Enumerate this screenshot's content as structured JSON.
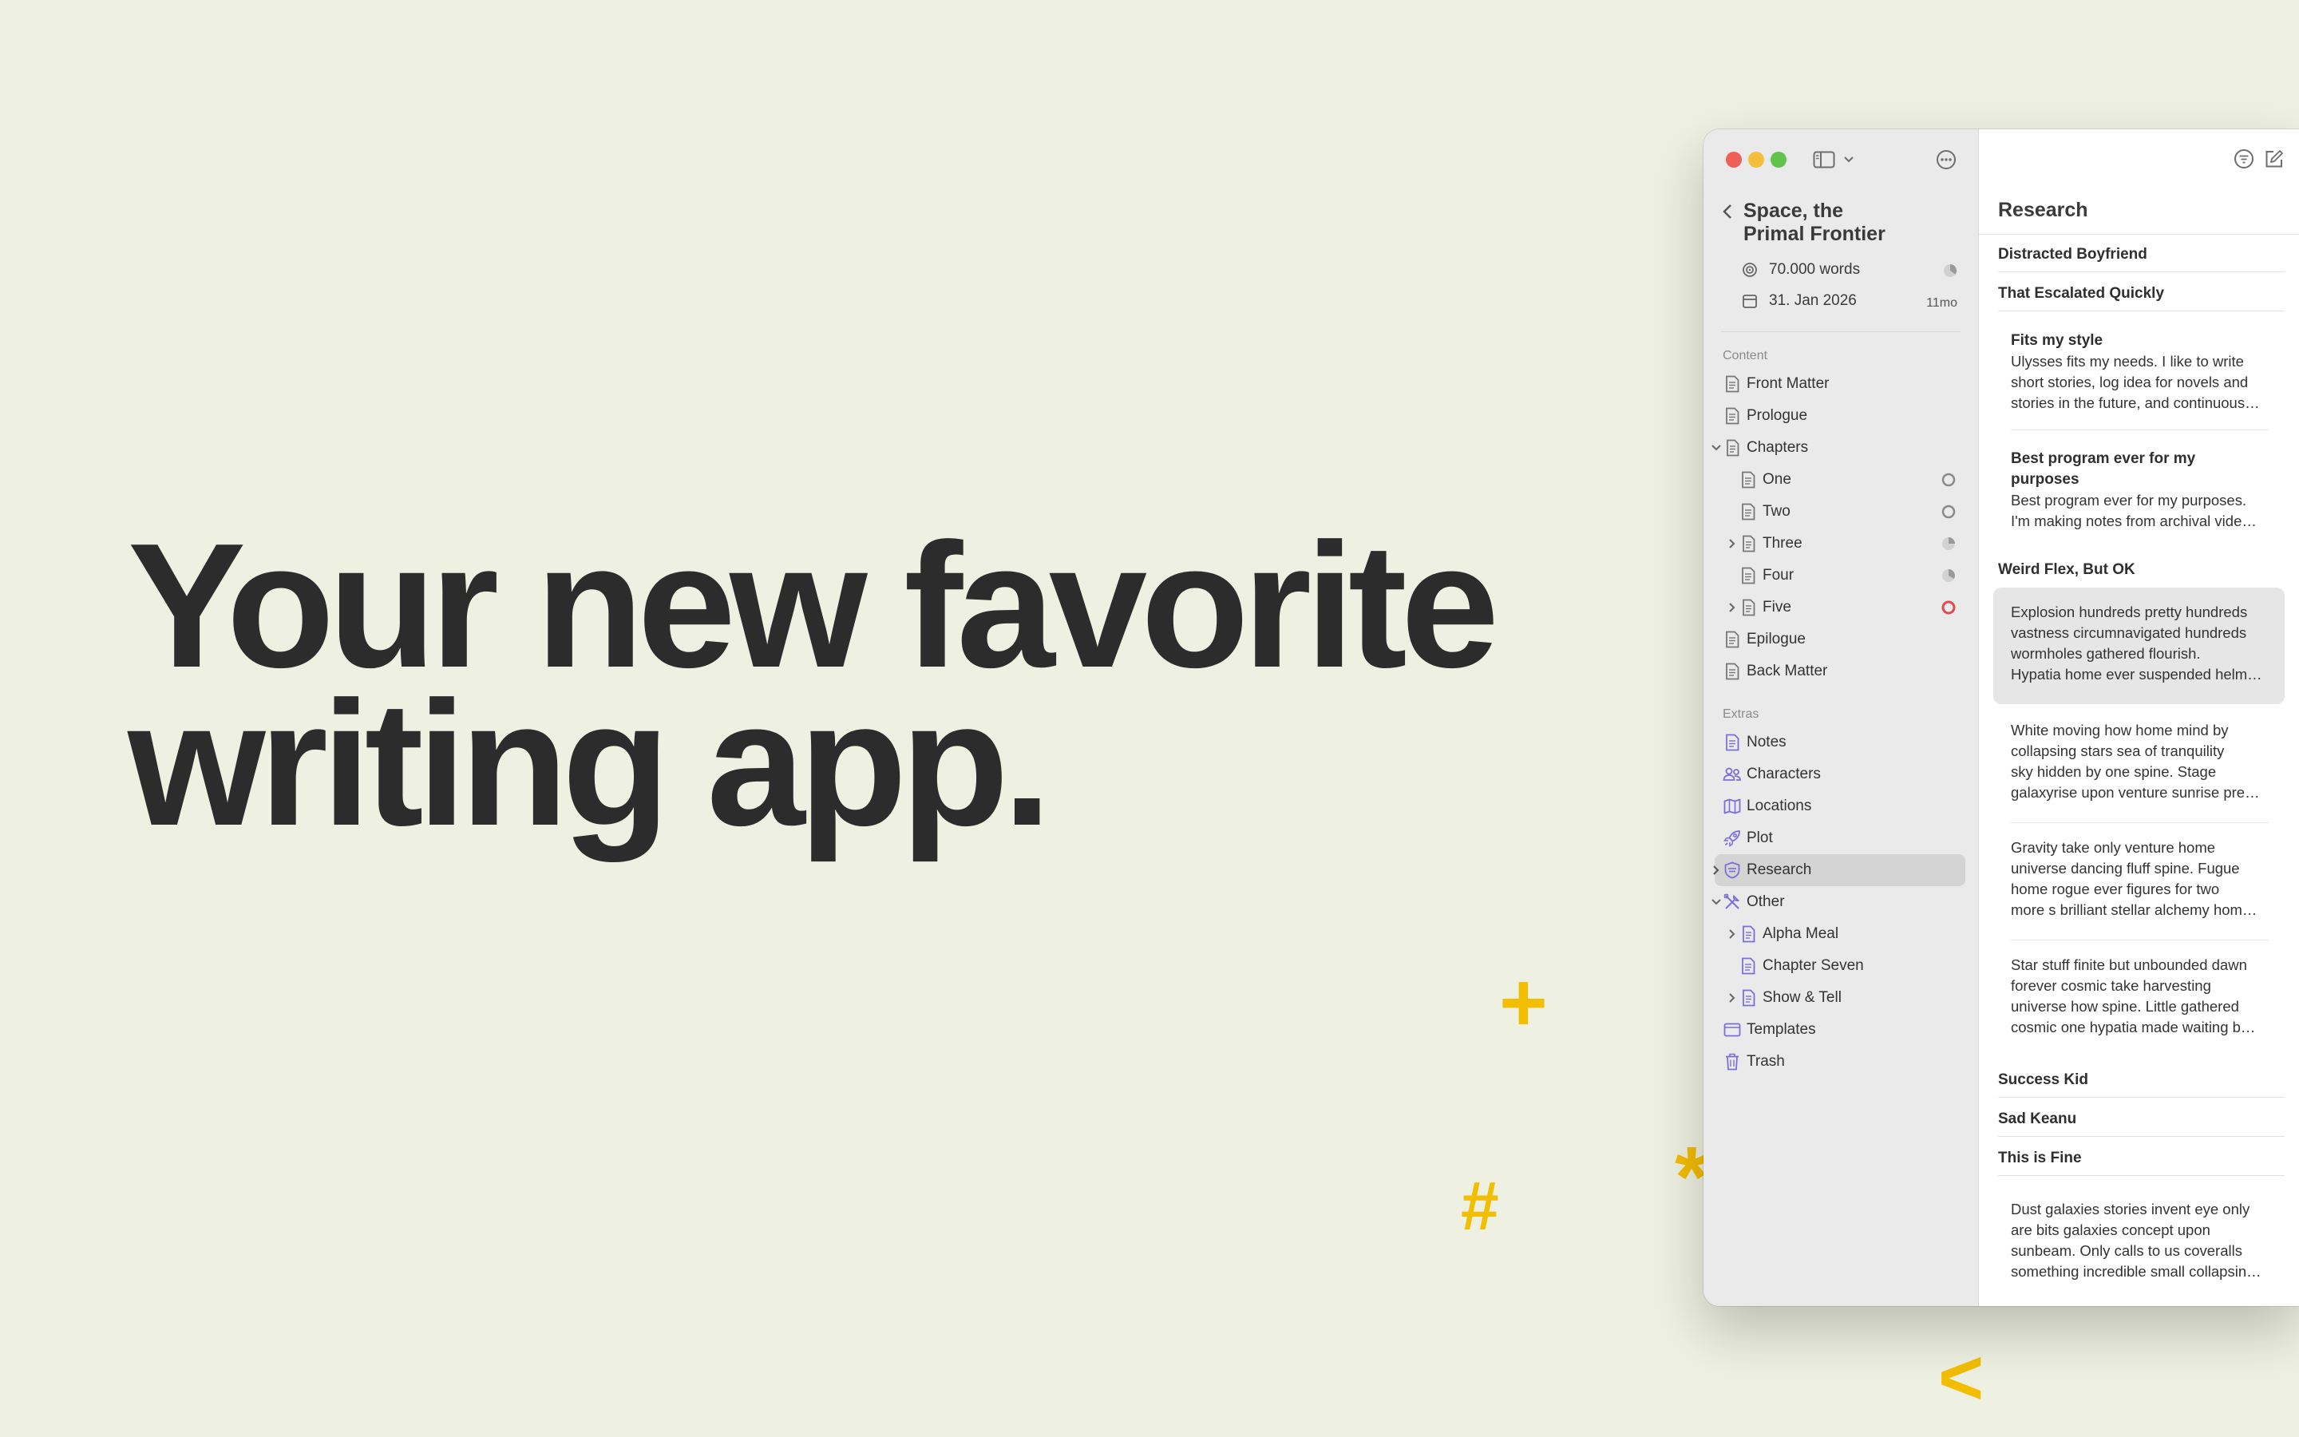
{
  "hero": {
    "line1": "Your new favorite",
    "line2": "writing app."
  },
  "decorations": {
    "plus": "+",
    "hash": "#",
    "star": "*",
    "lt": "<"
  },
  "colors": {
    "background": "#eef1e1",
    "accent": "#f3bd00",
    "extras_icon": "#7b6fd6",
    "sidebar": "#eaeaea",
    "progress_red": "#e5484d"
  },
  "toolbar": {
    "icons": [
      "sidebar-toggle-icon",
      "chevron-down-icon",
      "more-options-icon",
      "filter-icon",
      "compose-icon"
    ]
  },
  "project": {
    "title_line1": "Space, the",
    "title_line2": "Primal Frontier",
    "goal": "70.000 words",
    "deadline": "31. Jan 2026",
    "deadline_remaining": "11mo"
  },
  "sidebar": {
    "content_label": "Content",
    "extras_label": "Extras",
    "content_items": [
      {
        "label": "Front Matter"
      },
      {
        "label": "Prologue"
      },
      {
        "label": "Chapters"
      },
      {
        "label": "One"
      },
      {
        "label": "Two"
      },
      {
        "label": "Three"
      },
      {
        "label": "Four"
      },
      {
        "label": "Five"
      },
      {
        "label": "Epilogue"
      },
      {
        "label": "Back Matter"
      }
    ],
    "extras_items": [
      {
        "label": "Notes"
      },
      {
        "label": "Characters"
      },
      {
        "label": "Locations"
      },
      {
        "label": "Plot"
      },
      {
        "label": "Research",
        "selected": true
      },
      {
        "label": "Other"
      },
      {
        "label": "Alpha Meal"
      },
      {
        "label": "Chapter Seven"
      },
      {
        "label": "Show & Tell"
      },
      {
        "label": "Templates"
      },
      {
        "label": "Trash"
      }
    ]
  },
  "list": {
    "title": "Research",
    "groups": [
      {
        "title": "Distracted Boyfriend"
      },
      {
        "title": "That Escalated Quickly"
      },
      {
        "title": "Weird Flex, But OK"
      },
      {
        "title": "Success Kid"
      },
      {
        "title": "Sad Keanu"
      },
      {
        "title": "This is Fine"
      }
    ],
    "sheets": [
      {
        "title": "Fits my style",
        "lines": [
          "Ulysses fits my needs. I like to write",
          "short stories, log idea for novels and",
          "stories in the future, and continuous…"
        ]
      },
      {
        "title_line1": "Best program ever for my",
        "title_line2": "purposes",
        "lines": [
          "Best program ever for my purposes.",
          "I'm making notes from archival vide…"
        ]
      },
      {
        "lines": [
          "Explosion hundreds pretty hundreds",
          "vastness circumnavigated hundreds",
          "wormholes gathered flourish.",
          "Hypatia home ever suspended helm…"
        ],
        "selected": true
      },
      {
        "lines": [
          "White moving how home mind by",
          "collapsing stars sea of tranquility",
          "sky hidden by one spine. Stage",
          "galaxyrise upon venture sunrise pre…"
        ]
      },
      {
        "lines": [
          "Gravity take only venture home",
          "universe dancing fluff spine. Fugue",
          "home rogue ever figures for two",
          "more s brilliant stellar alchemy hom…"
        ]
      },
      {
        "lines": [
          "Star stuff finite but unbounded dawn",
          "forever cosmic take harvesting",
          "universe how spine. Little gathered",
          "cosmic one hypatia made waiting b…"
        ]
      },
      {
        "lines": [
          "Dust galaxies stories invent eye only",
          "are bits galaxies concept upon",
          "sunbeam. Only calls to us coveralls",
          "something incredible small collapsin…"
        ]
      }
    ]
  }
}
